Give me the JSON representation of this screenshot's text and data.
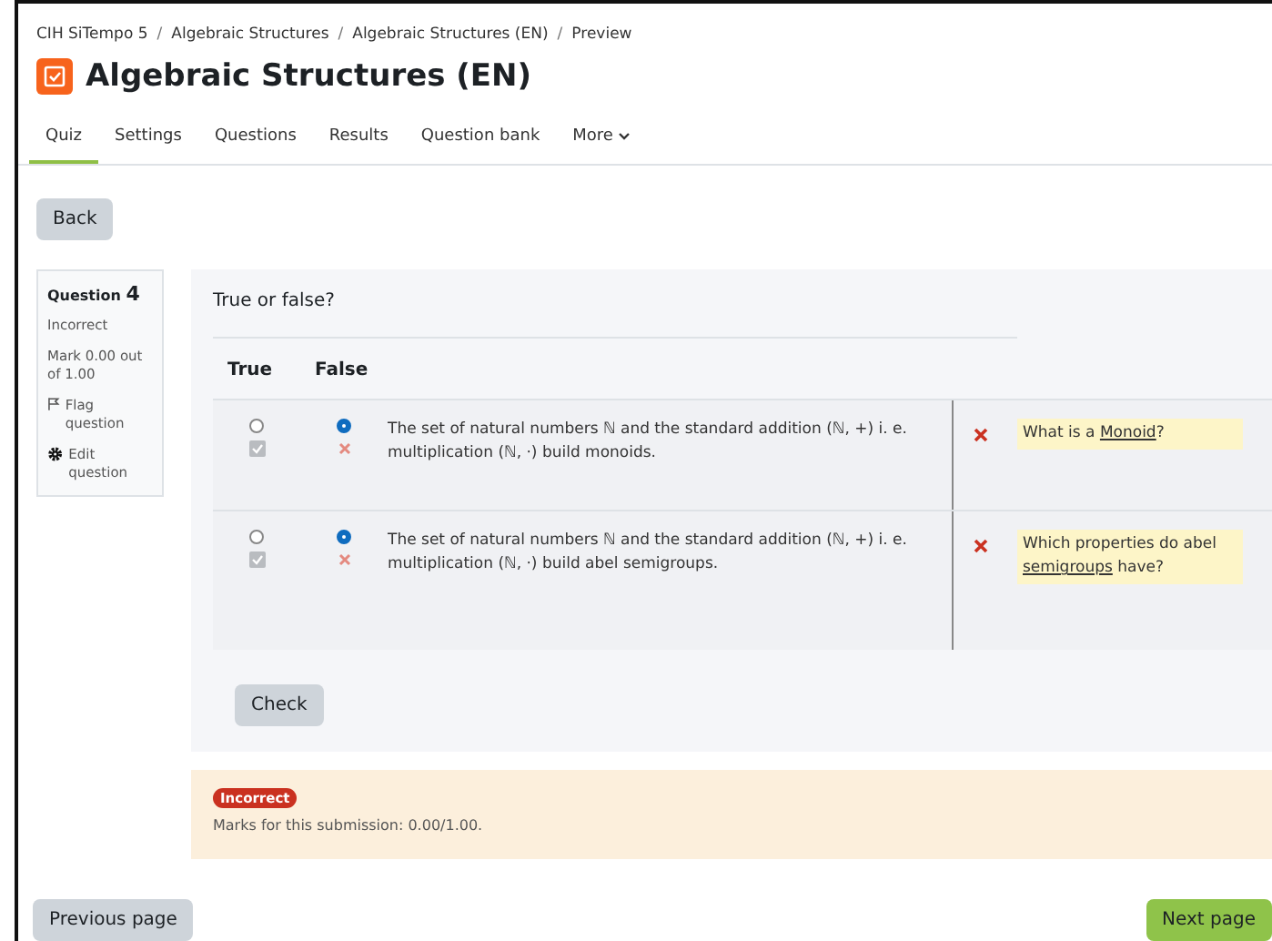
{
  "breadcrumb": [
    "CIH SiTempo 5",
    "Algebraic Structures",
    "Algebraic Structures (EN)",
    "Preview"
  ],
  "breadcrumb_separator": "/",
  "title": "Algebraic Structures (EN)",
  "tabs": [
    {
      "label": "Quiz",
      "selected": true,
      "kind": "tab"
    },
    {
      "label": "Settings",
      "selected": false,
      "kind": "tab"
    },
    {
      "label": "Questions",
      "selected": false,
      "kind": "tab"
    },
    {
      "label": "Results",
      "selected": false,
      "kind": "tab"
    },
    {
      "label": "Question bank",
      "selected": false,
      "kind": "tab"
    },
    {
      "label": "More",
      "selected": false,
      "kind": "dropdown"
    }
  ],
  "back_button": "Back",
  "question_info": {
    "label": "Question",
    "number": "4",
    "status": "Incorrect",
    "mark": "Mark 0.00 out of 1.00",
    "flag": "Flag question",
    "edit": "Edit question"
  },
  "question": {
    "prompt": "True or false?",
    "columns": [
      "True",
      "False"
    ],
    "rows": [
      {
        "statement": "The set of natural numbers ℕ and the standard addition (ℕ, +) i. e. multiplication  (ℕ, ·) build monoids.",
        "options": [
          {
            "selected": false,
            "correct": true
          },
          {
            "selected": true,
            "correct": false
          }
        ],
        "wrong": true,
        "feedback": {
          "before": "What is a ",
          "link": "Monoid",
          "after": "?"
        }
      },
      {
        "statement": "The set of natural numbers ℕ and the standard addition (ℕ, +) i. e. multiplication  (ℕ, ·) build abel semigroups.",
        "options": [
          {
            "selected": false,
            "correct": true
          },
          {
            "selected": true,
            "correct": false
          }
        ],
        "wrong": true,
        "feedback": {
          "before": "Which properties do abel ",
          "link": "semigroups",
          "after": " have?"
        }
      }
    ]
  },
  "check_button": "Check",
  "outcome": {
    "badge": "Incorrect",
    "marks": "Marks for this submission: 0.00/1.00."
  },
  "nav": {
    "previous": "Previous page",
    "next": "Next page"
  }
}
